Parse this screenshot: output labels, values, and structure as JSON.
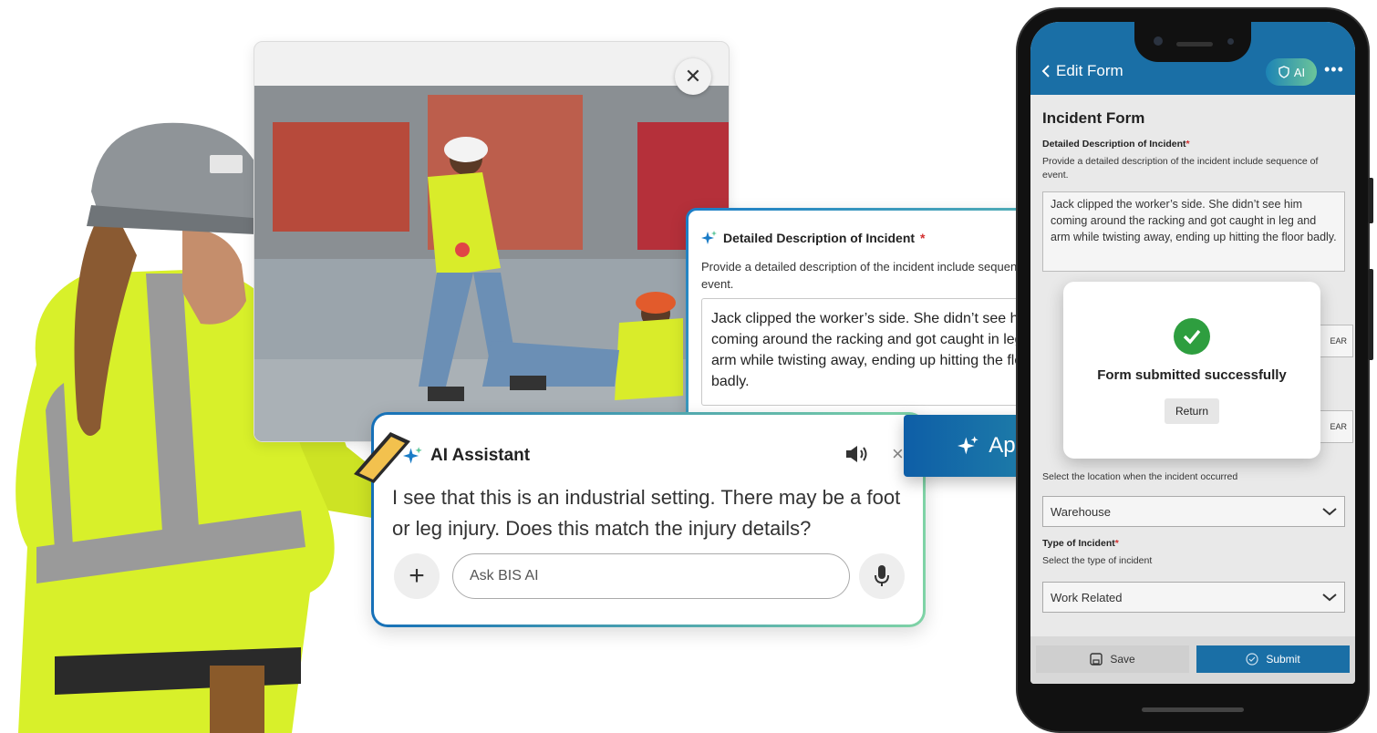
{
  "photo_card": {
    "close_icon": "close-icon"
  },
  "description_card": {
    "title": "Detailed Description of Incident",
    "required_mark": "*",
    "help": "Provide a detailed description of the incident include sequence of event.",
    "value": "Jack clipped the worker’s side. She didn’t see him coming around the racking and got caught in leg and arm while twisting away, ending up hitting the floor badly."
  },
  "ai_assistant": {
    "title": "AI Assistant",
    "message": "I see that this is an industrial setting. There may be a foot or leg injury. Does this match the injury details?",
    "input_placeholder": "Ask BIS AI",
    "close_label": "×"
  },
  "approve": {
    "label": "Approve All"
  },
  "phone": {
    "back_label": "Edit Form",
    "ai_chip_label": "AI",
    "more_label": "•••",
    "form_title": "Incident Form",
    "desc_label": "Detailed Description of Incident",
    "desc_help": "Provide a detailed description of the incident include sequence of event.",
    "desc_value": "Jack clipped the worker’s side. She didn’t see him coming around the racking and got caught in leg and arm while twisting away, ending up hitting the floor badly.",
    "clear_label": "EAR",
    "clear_label_2": "EAR",
    "location_help": "Select the location when the incident occurred",
    "location_value": "Warehouse",
    "type_label": "Type of Incident",
    "type_help": "Select the type of incident",
    "type_value": "Work Related",
    "required_mark": "*",
    "save_label": "Save",
    "submit_label": "Submit",
    "success_text": "Form submitted successfully",
    "return_label": "Return",
    "accent_color": "#1a6fa6",
    "success_color": "#2e9e3f"
  }
}
